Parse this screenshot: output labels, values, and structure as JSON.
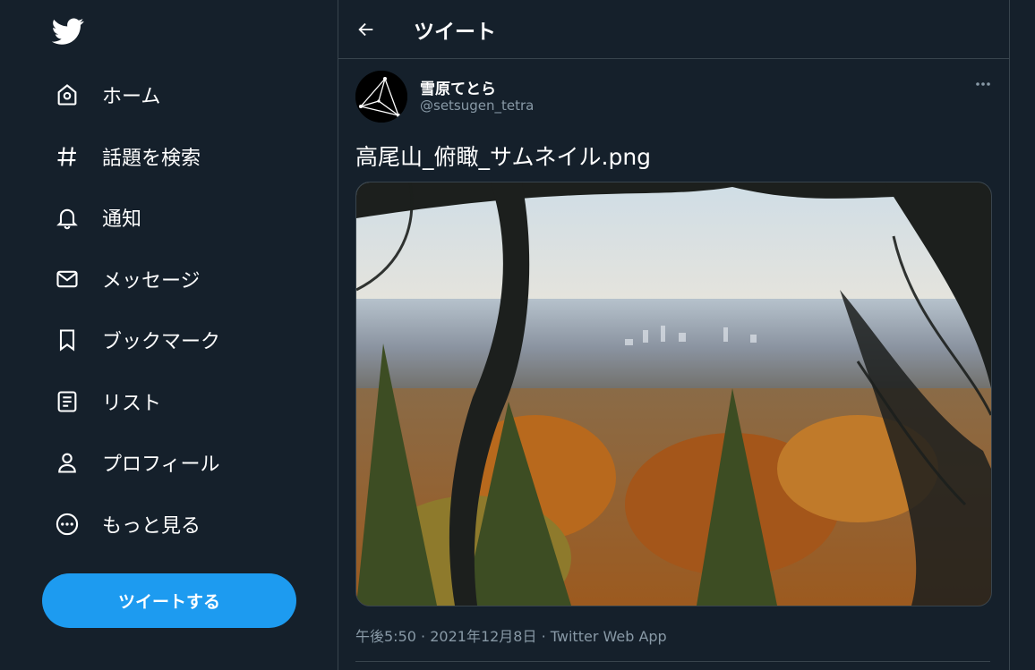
{
  "nav": [
    {
      "label": "ホーム",
      "icon": "home-icon"
    },
    {
      "label": "話題を検索",
      "icon": "hashtag-icon"
    },
    {
      "label": "通知",
      "icon": "bell-icon"
    },
    {
      "label": "メッセージ",
      "icon": "envelope-icon"
    },
    {
      "label": "ブックマーク",
      "icon": "bookmark-icon"
    },
    {
      "label": "リスト",
      "icon": "list-icon"
    },
    {
      "label": "プロフィール",
      "icon": "person-icon"
    },
    {
      "label": "もっと見る",
      "icon": "more-circle-icon"
    }
  ],
  "tweet_button": "ツイートする",
  "header": {
    "title": "ツイート"
  },
  "tweet": {
    "author_name": "雪原てとら",
    "author_handle": "@setsugen_tetra",
    "text": "高尾山_俯瞰_サムネイル.png",
    "time": "午後5:50",
    "date": "2021年12月8日",
    "source": "Twitter Web App",
    "separator": "·"
  },
  "colors": {
    "background": "#15202b",
    "accent": "#1d9bf0",
    "border": "#38444d",
    "secondary_text": "#8899a6"
  }
}
